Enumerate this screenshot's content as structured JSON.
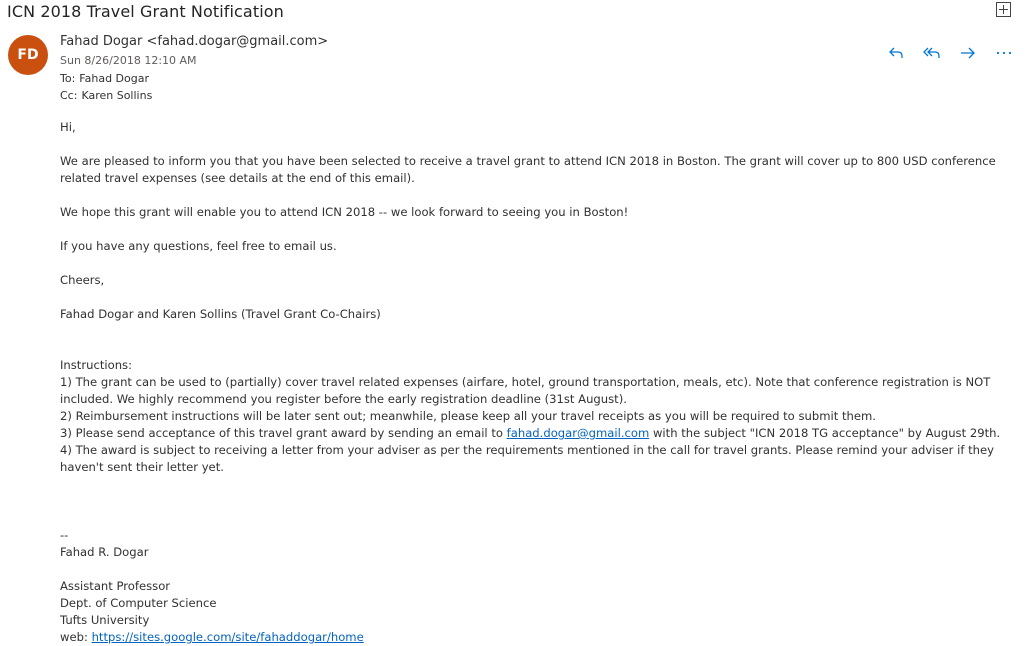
{
  "subject": "ICN 2018 Travel Grant Notification",
  "colors": {
    "avatar_bg": "#ca5010",
    "accent": "#0078d4",
    "link": "#0563c1"
  },
  "sender": {
    "initials": "FD",
    "display": "Fahad Dogar <fahad.dogar@gmail.com>",
    "date": "Sun 8/26/2018 12:10 AM"
  },
  "recipients": {
    "to_label": "To:",
    "to": "Fahad Dogar",
    "cc_label": "Cc:",
    "cc": "Karen Sollins"
  },
  "actions": [
    "reply-icon",
    "reply-all-icon",
    "forward-icon",
    "more-icon"
  ],
  "body": {
    "greeting": "Hi,",
    "para1": "We are pleased to inform you that you have been selected to receive a travel grant to attend ICN 2018 in Boston. The grant will cover up to 800 USD conference related travel expenses (see details at the end of this email).",
    "para2": "We hope this grant will enable you to attend ICN 2018 -- we look forward to seeing you in Boston!",
    "para3": "If you have any questions, feel free to email us.",
    "closing": "Cheers,",
    "signoff": "Fahad Dogar and Karen Sollins (Travel Grant Co-Chairs)",
    "instructions_title": "Instructions:",
    "item1": "1) The grant can be used to (partially) cover travel related expenses (airfare, hotel, ground transportation, meals, etc). Note that conference registration is NOT included. We highly recommend you register before the early registration deadline (31st August).",
    "item2": "2) Reimbursement instructions will be later sent out; meanwhile, please keep all your travel receipts as you will be required to submit them.",
    "item3_pre": "3) Please send acceptance of this travel grant award by sending an email to ",
    "item3_link": "fahad.dogar@gmail.com",
    "item3_post": " with the subject \"ICN 2018 TG acceptance\" by August 29th.",
    "item4": "4) The award is subject to receiving a letter from your adviser as per the requirements mentioned in the call for travel grants. Please remind your adviser if they haven't sent their letter yet."
  },
  "signature": {
    "dashes": "--",
    "name": "Fahad R. Dogar",
    "title": "Assistant Professor",
    "dept": "Dept. of Computer Science",
    "university": "Tufts University",
    "web_label": "web: ",
    "web_link": "https://sites.google.com/site/fahaddogar/home"
  }
}
